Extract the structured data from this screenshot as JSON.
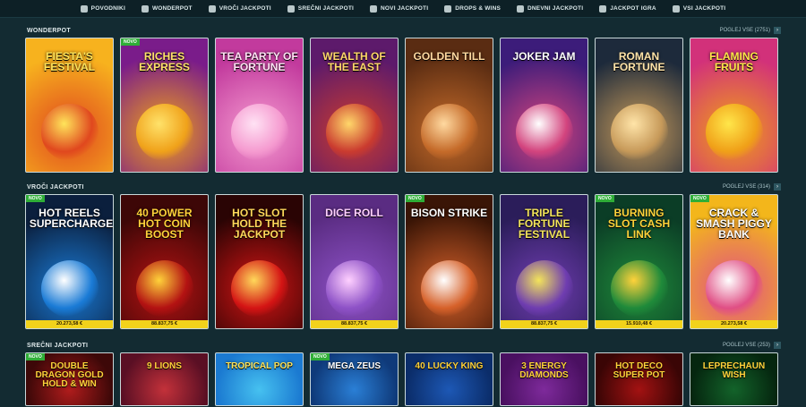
{
  "nav": [
    {
      "label": "POVODNIKI",
      "icon": "book-icon"
    },
    {
      "label": "WONDERPOT",
      "icon": "wonderpot-icon"
    },
    {
      "label": "VROČI JACKPOTI",
      "icon": "flame-icon"
    },
    {
      "label": "SREČNI JACKPOTI",
      "icon": "clover-icon"
    },
    {
      "label": "NOVI JACKPOTI",
      "icon": "bell-icon"
    },
    {
      "label": "DROPS & WINS",
      "icon": "drops-icon"
    },
    {
      "label": "DNEVNI JACKPOTI",
      "icon": "calendar-icon"
    },
    {
      "label": "JACKPOT IGRA",
      "icon": "rocket-icon"
    },
    {
      "label": "VSI JACKPOTI",
      "icon": "globe-icon"
    }
  ],
  "sections": [
    {
      "title": "WONDERPOT",
      "see_all": "POGLEJ VSE (2751)",
      "games": [
        {
          "title": "Fiesta's Festival",
          "badge": "",
          "prize": ""
        },
        {
          "title": "Riches Express",
          "badge": "NOVO",
          "prize": ""
        },
        {
          "title": "Tea Party of Fortune",
          "badge": "",
          "prize": ""
        },
        {
          "title": "Wealth of the East",
          "badge": "",
          "prize": ""
        },
        {
          "title": "Golden Till",
          "badge": "",
          "prize": ""
        },
        {
          "title": "Joker Jam",
          "badge": "",
          "prize": ""
        },
        {
          "title": "Roman Fortune",
          "badge": "",
          "prize": ""
        },
        {
          "title": "Flaming Fruits",
          "badge": "",
          "prize": ""
        }
      ]
    },
    {
      "title": "VROČI JACKPOTI",
      "see_all": "POGLEJ VSE (314)",
      "games": [
        {
          "title": "Hot Reels Supercharged",
          "badge": "NOVO",
          "prize": "20.273,58 €"
        },
        {
          "title": "40 Power Hot Coin Boost",
          "badge": "",
          "prize": "88.837,75 €"
        },
        {
          "title": "Hot Slot Hold the Jackpot",
          "badge": "",
          "prize": ""
        },
        {
          "title": "Dice Roll",
          "badge": "",
          "prize": "88.837,75 €"
        },
        {
          "title": "Bison Strike",
          "badge": "NOVO",
          "prize": ""
        },
        {
          "title": "Triple Fortune Festival",
          "badge": "",
          "prize": "88.837,75 €"
        },
        {
          "title": "Burning Slot Cash Link",
          "badge": "NOVO",
          "prize": "15.910,48 €"
        },
        {
          "title": "Crack & Smash Piggy Bank",
          "badge": "NOVO",
          "prize": "20.273,58 €"
        }
      ]
    },
    {
      "title": "SREČNI JACKPOTI",
      "see_all": "POGLEJ VSE (253)",
      "games": [
        {
          "title": "Double Dragon Gold Hold & Win",
          "badge": "NOVO",
          "prize": ""
        },
        {
          "title": "9 Lions",
          "badge": "",
          "prize": ""
        },
        {
          "title": "Tropical Pop",
          "badge": "",
          "prize": ""
        },
        {
          "title": "Mega Zeus",
          "badge": "NOVO",
          "prize": ""
        },
        {
          "title": "40 Lucky King",
          "badge": "",
          "prize": ""
        },
        {
          "title": "3 Energy Diamonds",
          "badge": "",
          "prize": ""
        },
        {
          "title": "Hot Deco Super Pot",
          "badge": "",
          "prize": ""
        },
        {
          "title": "Leprechaun Wish",
          "badge": "",
          "prize": ""
        }
      ]
    }
  ],
  "colors": {
    "background": "#132b32",
    "accent": "#f2d21b",
    "badge": "#2fae37"
  }
}
